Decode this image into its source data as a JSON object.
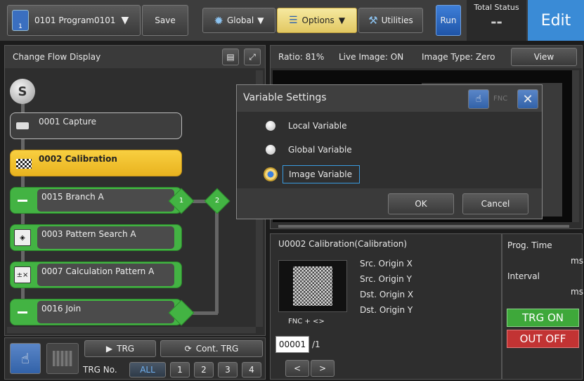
{
  "toolbar": {
    "program_label": "0101  Program0101",
    "save": "Save",
    "global": "Global",
    "options": "Options",
    "utilities": "Utilities",
    "run": "Run",
    "total_status_label": "Total Status",
    "total_status_value": "--",
    "edit": "Edit"
  },
  "left_panel": {
    "title": "Change  Flow  Display",
    "start": "S",
    "items": [
      {
        "label": "0001  Capture"
      },
      {
        "label": "0002  Calibration"
      },
      {
        "label": "0015  Branch   A"
      },
      {
        "label": "0003  Pattern  Search  A"
      },
      {
        "label": "0007  Calculation  Pattern  A"
      },
      {
        "label": "0016  Join"
      }
    ],
    "branch_node_1": "1",
    "branch_node_2": "2",
    "trg": "TRG",
    "cont_trg": "Cont.  TRG",
    "trg_no": "TRG  No.",
    "trg_all": "ALL",
    "trg_nums": [
      "1",
      "2",
      "3",
      "4"
    ]
  },
  "right_panel": {
    "ratio": "Ratio:  81%",
    "live_image": "Live  Image:  ON",
    "image_type": "Image  Type:  Zero",
    "view": "View",
    "unit_title": "U0002  Calibration(Calibration)",
    "origin_rows": [
      "Src.   Origin  X",
      "Src.   Origin  Y",
      "Dst.   Origin  X",
      "Dst.   Origin  Y"
    ],
    "fnc_label": "FNC  +  <>",
    "page_input": "00001",
    "page_total": "/1",
    "prev": "<",
    "next": ">",
    "prog_time": "Prog.  Time",
    "ms1": "ms",
    "interval": "Interval",
    "ms2": "ms",
    "trg_on": "TRG ON",
    "out_off": "OUT OFF"
  },
  "dialog": {
    "title": "Variable  Settings",
    "fnc": "FNC",
    "options": [
      "Local  Variable",
      "Global  Variable",
      "Image  Variable"
    ],
    "selected_index": 2,
    "ok": "OK",
    "cancel": "Cancel"
  },
  "colors": {
    "accent_blue": "#3a8bd6",
    "flow_green": "#43b343",
    "calibration_yellow": "#f4c12a",
    "trg_on_green": "#3ea83a",
    "out_off_red": "#c23333"
  }
}
